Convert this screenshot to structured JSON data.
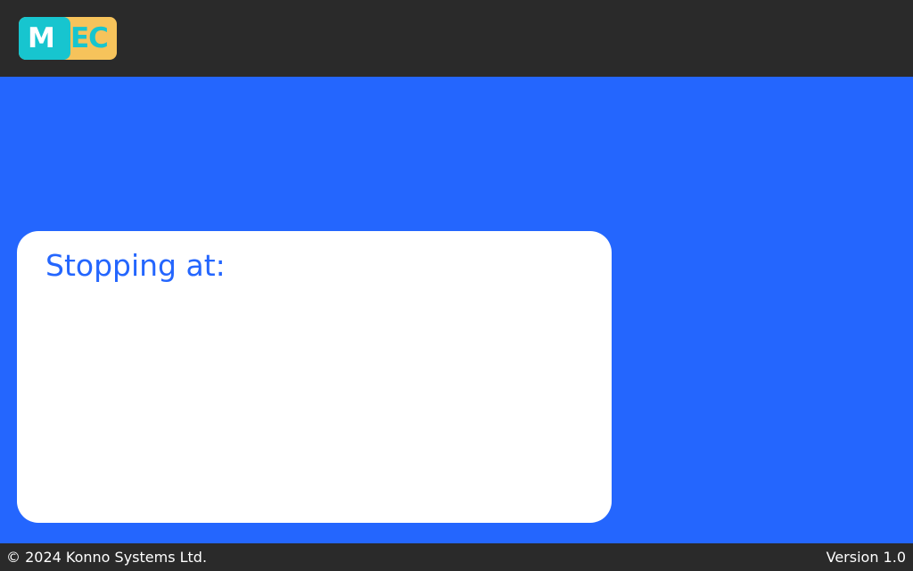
{
  "header": {
    "logo": {
      "text_main": "M",
      "text_accent": "EC",
      "colors": {
        "teal": "#17c5cf",
        "yellow": "#f6c35b"
      }
    }
  },
  "main": {
    "card_title": "Stopping at:",
    "background_color": "#2466fe"
  },
  "footer": {
    "copyright": "© 2024 Konno Systems Ltd.",
    "version": "Version 1.0"
  },
  "colors": {
    "topbar": "#2a2a2a",
    "card": "#ffffff",
    "accent": "#2466fe"
  }
}
